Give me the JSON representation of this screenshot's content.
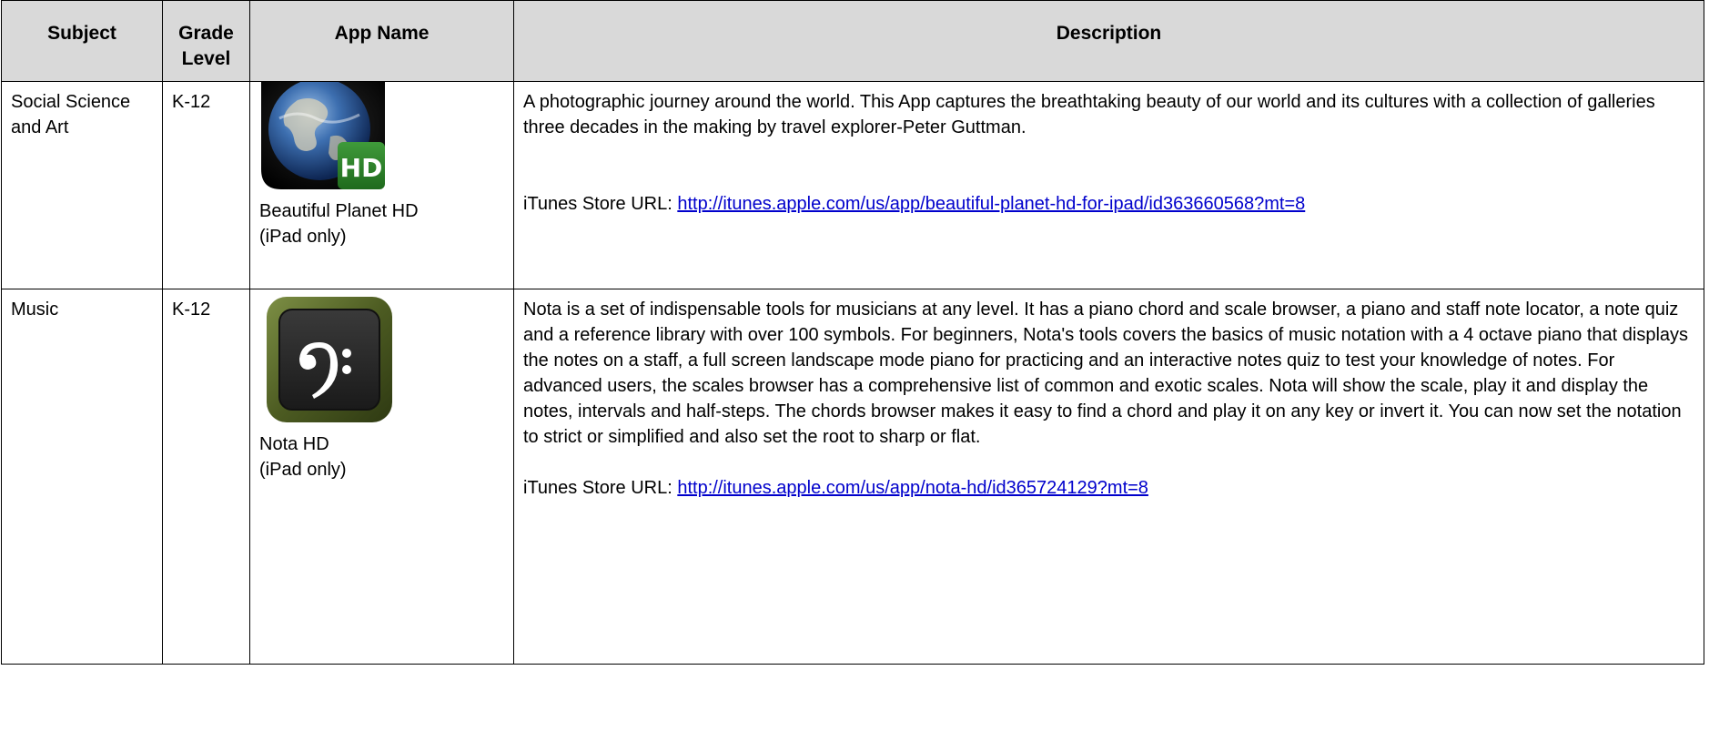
{
  "table": {
    "headers": {
      "subject": "Subject",
      "grade_level": "Grade Level",
      "app_name": "App Name",
      "description": "Description"
    },
    "rows": [
      {
        "subject": "Social Science and Art",
        "grade": "K-12",
        "app_name": "Beautiful Planet HD",
        "app_note": "(iPad only)",
        "icon": "globe-hd-icon",
        "description": "A photographic journey around the world.  This App captures the breathtaking beauty of our world and its cultures with a collection of galleries three decades in the making by travel explorer-Peter Guttman.",
        "url_label": "iTunes Store URL: ",
        "url": "http://itunes.apple.com/us/app/beautiful-planet-hd-for-ipad/id363660568?mt=8"
      },
      {
        "subject": "Music",
        "grade": "K-12",
        "app_name": "Nota HD",
        "app_note": "(iPad only)",
        "icon": "bass-clef-icon",
        "description": "Nota is a set of indispensable tools for musicians at any level. It has a piano chord and scale browser, a piano and staff note locator, a note quiz and a reference library with over 100 symbols. For beginners, Nota's tools covers the basics of music notation with a 4 octave piano that displays the notes on a staff, a full screen landscape mode piano for practicing and an interactive notes quiz to test your knowledge of notes.  For advanced users, the scales browser has a comprehensive list of common and exotic scales. Nota will show the scale, play it and display the notes, intervals and half-steps. The chords browser makes it easy to find a chord and play it on any key or invert it. You can now set the notation to strict or simplified and also set the root to sharp or flat.",
        "url_label": "iTunes Store URL: ",
        "url": "http://itunes.apple.com/us/app/nota-hd/id365724129?mt=8"
      }
    ],
    "colors": {
      "header_bg": "#d9d9d9",
      "link": "#0000cc",
      "border": "#000000"
    }
  }
}
